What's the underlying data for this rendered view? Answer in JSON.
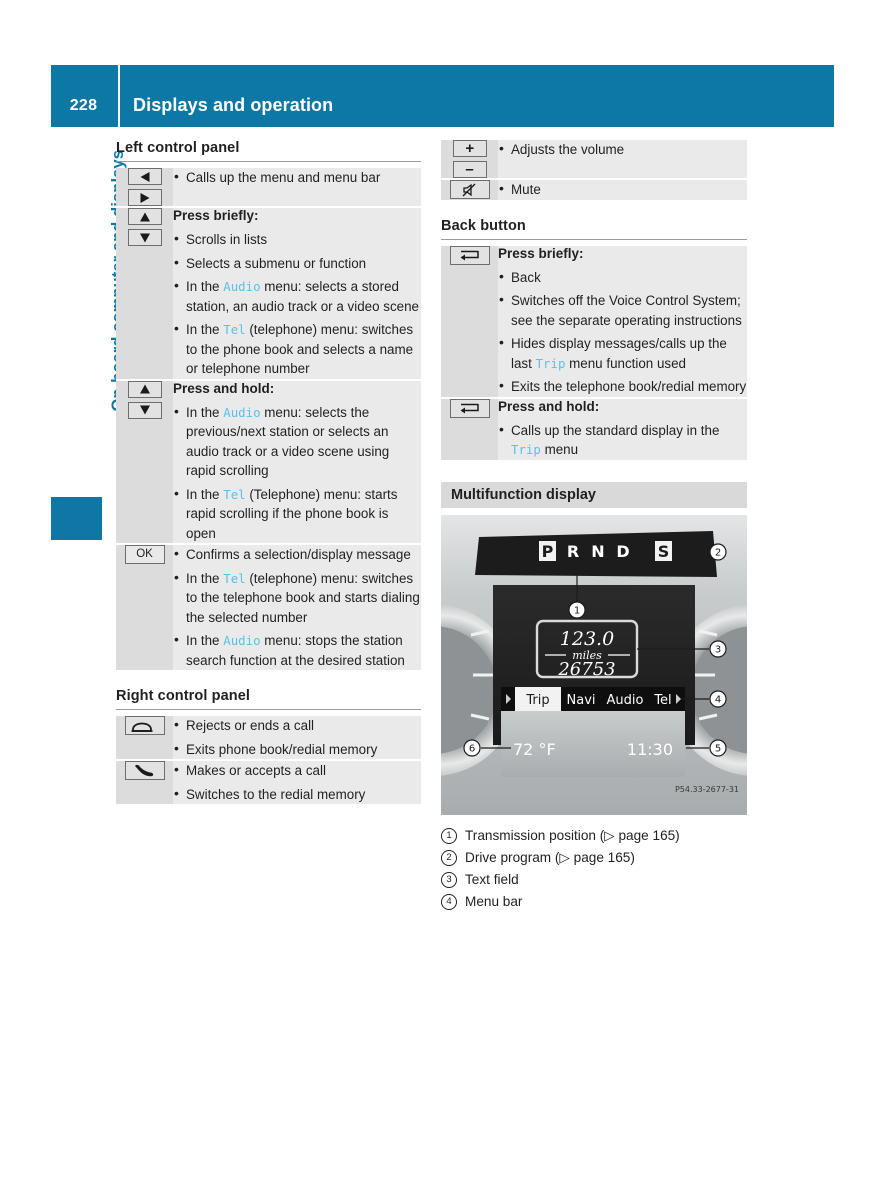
{
  "header": {
    "page_number": "228",
    "title": "Displays and operation"
  },
  "chapter_tab": {
    "label": "On-board computer and displays",
    "accent_color": "#0d78a4"
  },
  "left_column": {
    "sections": [
      {
        "title": "Left control panel",
        "rows": [
          {
            "icons": [
              "triangle-left-key",
              "triangle-right-key"
            ],
            "subhead": "",
            "bullets": [
              [
                {
                  "t": "Calls up the menu and menu bar"
                }
              ]
            ]
          },
          {
            "icons": [
              "triangle-up-key",
              "triangle-down-key"
            ],
            "subhead": "Press briefly:",
            "bullets": [
              [
                {
                  "t": "Scrolls in lists"
                }
              ],
              [
                {
                  "t": "Selects a submenu or function"
                }
              ],
              [
                {
                  "t": "In the "
                },
                {
                  "t": "Audio",
                  "term": true
                },
                {
                  "t": " menu: selects a stored station, an audio track or a video scene"
                }
              ],
              [
                {
                  "t": "In the "
                },
                {
                  "t": "Tel",
                  "term": true
                },
                {
                  "t": " (telephone) menu: switches to the phone book and selects a name or telephone number"
                }
              ]
            ]
          },
          {
            "icons": [
              "triangle-up-key",
              "triangle-down-key"
            ],
            "subhead": "Press and hold:",
            "bullets": [
              [
                {
                  "t": "In the "
                },
                {
                  "t": "Audio",
                  "term": true
                },
                {
                  "t": " menu: selects the previous/next station or selects an audio track or a video scene using rapid scrolling"
                }
              ],
              [
                {
                  "t": "In the "
                },
                {
                  "t": "Tel",
                  "term": true
                },
                {
                  "t": " (Telephone) menu: starts rapid scrolling if the phone book is open"
                }
              ]
            ]
          },
          {
            "icons": [
              "ok-key"
            ],
            "ok_label": "OK",
            "subhead": "",
            "bullets": [
              [
                {
                  "t": "Confirms a selection/display message"
                }
              ],
              [
                {
                  "t": "In the "
                },
                {
                  "t": "Tel",
                  "term": true
                },
                {
                  "t": " (telephone) menu: switches to the telephone book and starts dialing the selected number"
                }
              ],
              [
                {
                  "t": "In the "
                },
                {
                  "t": "Audio",
                  "term": true
                },
                {
                  "t": " menu: stops the station search function at the desired station"
                }
              ]
            ]
          }
        ]
      },
      {
        "title": "Right control panel",
        "rows": [
          {
            "icons": [
              "phone-hangup-key"
            ],
            "subhead": "",
            "bullets": [
              [
                {
                  "t": "Rejects or ends a call"
                }
              ],
              [
                {
                  "t": "Exits phone book/redial memory"
                }
              ]
            ]
          },
          {
            "icons": [
              "phone-pickup-key"
            ],
            "subhead": "",
            "bullets": [
              [
                {
                  "t": "Makes or accepts a call"
                }
              ],
              [
                {
                  "t": "Switches to the redial memory"
                }
              ]
            ]
          }
        ]
      }
    ]
  },
  "right_column": {
    "volume_rows": [
      {
        "icons": [
          "plus-key",
          "minus-key"
        ],
        "subhead": "",
        "bullets": [
          [
            {
              "t": "Adjusts the volume"
            }
          ]
        ]
      },
      {
        "icons": [
          "mute-key"
        ],
        "subhead": "",
        "bullets": [
          [
            {
              "t": "Mute"
            }
          ]
        ]
      }
    ],
    "back_button": {
      "title": "Back button",
      "rows": [
        {
          "icons": [
            "back-key"
          ],
          "subhead": "Press briefly:",
          "bullets": [
            [
              {
                "t": "Back"
              }
            ],
            [
              {
                "t": "Switches off the Voice Control System; see the separate operating instructions"
              }
            ],
            [
              {
                "t": "Hides display messages/calls up the last "
              },
              {
                "t": "Trip",
                "term": true
              },
              {
                "t": " menu function used"
              }
            ],
            [
              {
                "t": "Exits the telephone book/redial memory"
              }
            ]
          ]
        },
        {
          "icons": [
            "back-key"
          ],
          "subhead": "Press and hold:",
          "bullets": [
            [
              {
                "t": "Calls up the standard display in the "
              },
              {
                "t": "Trip",
                "term": true
              },
              {
                "t": " menu"
              }
            ]
          ]
        }
      ]
    },
    "multifunction_display": {
      "title": "Multifunction display",
      "figure": {
        "gear_positions": [
          "P",
          "R",
          "N",
          "D"
        ],
        "gear_highlighted": "P",
        "drive_program": "S",
        "trip_value": "123.0",
        "trip_unit": "miles",
        "odometer": "26753",
        "menu_bar": [
          "Trip",
          "Navi",
          "Audio",
          "Tel"
        ],
        "menu_selected": "Trip",
        "temperature": "72 °F",
        "clock": "11:30",
        "figure_code": "P54.33-2677-31",
        "callouts": [
          "1",
          "2",
          "3",
          "4",
          "5",
          "6"
        ]
      },
      "legend": [
        {
          "num": "1",
          "text": "Transmission position (▷ page 165)"
        },
        {
          "num": "2",
          "text": "Drive program (▷ page 165)"
        },
        {
          "num": "3",
          "text": "Text field"
        },
        {
          "num": "4",
          "text": "Menu bar"
        }
      ]
    }
  }
}
